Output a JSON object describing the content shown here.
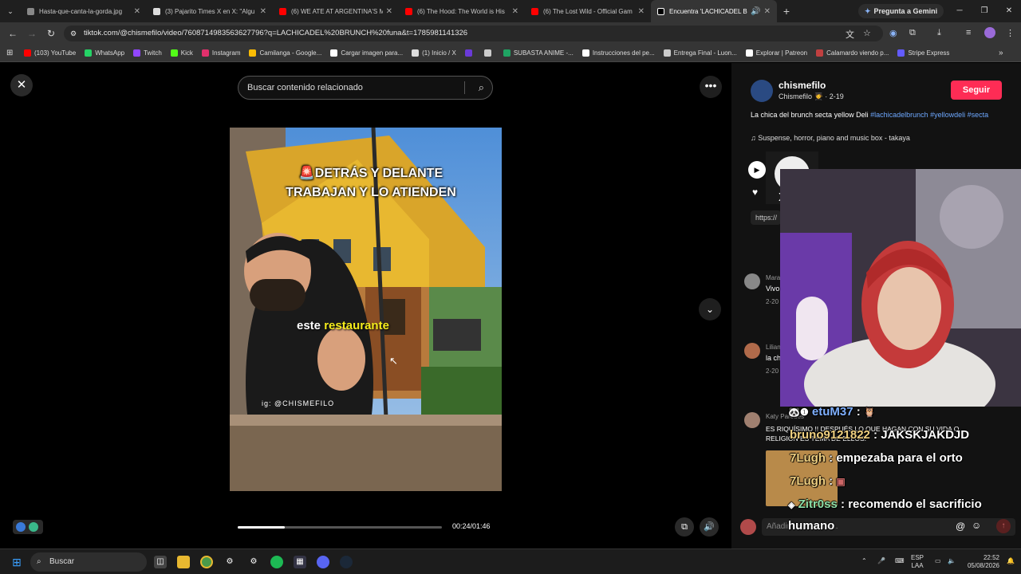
{
  "tabs": [
    {
      "title": "Hasta-que-canta-la-gorda.jpg",
      "color": "#888888"
    },
    {
      "title": "(3) Pajarito Times X en X: \"Algu",
      "color": "#dddddd"
    },
    {
      "title": "(6) WE ATE AT ARGENTINA'S M",
      "color": "#ff0000"
    },
    {
      "title": "(6) The Hood: The World is His",
      "color": "#ff0000"
    },
    {
      "title": "(6) The Lost Wild - Official Gam",
      "color": "#ff0000"
    },
    {
      "title": "Encuentra 'LACHICADEL BR",
      "color": "#ffffff",
      "active": true
    }
  ],
  "gemini_label": "Pregunta a Gemini",
  "url": "tiktok.com/@chismefilo/video/7608714983563627796?q=LACHICADEL%20BRUNCH%20funa&t=1785981141326",
  "bookmarks": [
    {
      "label": "(103) YouTube",
      "color": "#ff0000"
    },
    {
      "label": "WhatsApp",
      "color": "#25d366"
    },
    {
      "label": "Twitch",
      "color": "#9146ff"
    },
    {
      "label": "Kick",
      "color": "#53fc18"
    },
    {
      "label": "Instagram",
      "color": "#e1306c"
    },
    {
      "label": "Camilanga - Google...",
      "color": "#fbbc04"
    },
    {
      "label": "Cargar imagen para...",
      "color": "#ffffff"
    },
    {
      "label": "(1) Inicio / X",
      "color": "#dddddd"
    },
    {
      "label": "",
      "color": "#6a3ad8"
    },
    {
      "label": "",
      "color": "#cccccc"
    },
    {
      "label": "SUBASTA ANIME -...",
      "color": "#1fa463"
    },
    {
      "label": "Instrucciones del pe...",
      "color": "#ffffff"
    },
    {
      "label": "Entrega Final - Luon...",
      "color": "#cccccc"
    },
    {
      "label": "Explorar | Patreon",
      "color": "#ffffff"
    },
    {
      "label": "Calamardo viendo p...",
      "color": "#c04040"
    },
    {
      "label": "Stripe Express",
      "color": "#635bff"
    }
  ],
  "search_placeholder": "Buscar contenido relacionado",
  "video": {
    "overlay_top": "DETRÁS Y DELANTE TRABAJAN Y LO ATIENDEN",
    "caption_a": "este",
    "caption_b": "restaurante",
    "handle": "ig: @CHISMEFILO",
    "time": "00:24/01:46",
    "progress": 0.23
  },
  "author": {
    "name": "chismefilo",
    "sub": "Chismefilo 🧑‍🎓 · 2-19",
    "follow": "Seguir"
  },
  "description": {
    "text": "La chica del brunch secta yellow Deli ",
    "tags": "#lachicadelbrunch #yellowdeli #secta"
  },
  "music": "Suspense, horror, piano and music box - takaya",
  "link": "https://",
  "comments": [
    {
      "name": "Mara",
      "text": "Vivo",
      "date": "2-20"
    },
    {
      "name": "Lilian",
      "text": "la ch",
      "date": "2-20"
    },
    {
      "name": "Katy Paredes",
      "text": "ES RIQUÍSIMO !! DESPUÉS LO QUE HAGAN CON SU VIDA O RELIGIÓN ES TEMA DE ELLOS.",
      "date": ""
    }
  ],
  "chat": [
    {
      "user": "etuM37",
      "msg": ""
    },
    {
      "user": "bruno9121822",
      "msg": "JAKSKJAKDJD"
    },
    {
      "user": "7Lugh",
      "msg": "empezaba para el orto"
    },
    {
      "user": "7Lugh",
      "msg": ""
    },
    {
      "user": "Zitr0ss",
      "msg": "recomendo el sacrificio"
    },
    {
      "user": "",
      "msg": "humano"
    }
  ],
  "add_comment": "Añadir comentario...",
  "taskbar": {
    "search": "Buscar",
    "lang1": "ESP",
    "lang2": "LAA",
    "time": "22:52",
    "date": "05/08/2026"
  }
}
